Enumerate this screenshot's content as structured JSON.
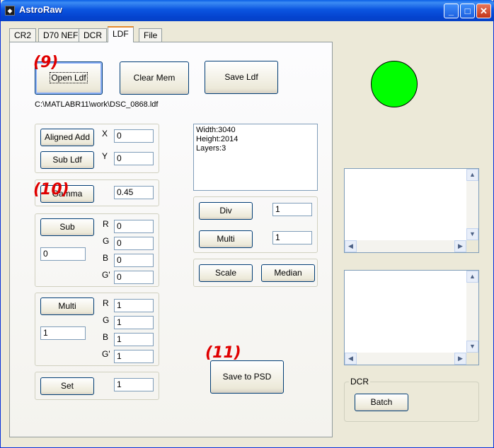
{
  "window": {
    "title": "AstroRaw",
    "minimize": "_",
    "maximize": "□",
    "close": "✕"
  },
  "tabs": [
    "CR2",
    "D70 NEF",
    "DCR",
    "LDF",
    "File"
  ],
  "active_tab": "LDF",
  "ldf": {
    "open_ldf": "Open Ldf",
    "clear_mem": "Clear Mem",
    "save_ldf": "Save Ldf",
    "file_path": "C:\\MATLABR11\\work\\DSC_0868.ldf",
    "aligned_add": "Aligned Add",
    "sub_ldf": "Sub Ldf",
    "x_label": "X",
    "x_value": "0",
    "y_label": "Y",
    "y_value": "0",
    "gamma": "Gamma",
    "gamma_value": "0.45",
    "info_lines": [
      "Width:3040",
      "Height:2014",
      "Layers:3"
    ],
    "div": "Div",
    "div_value": "1",
    "multi_top": "Multi",
    "multi_top_value": "1",
    "scale": "Scale",
    "median": "Median",
    "sub": "Sub",
    "sub_value": "0",
    "sub_r_label": "R",
    "sub_r": "0",
    "sub_g_label": "G",
    "sub_g": "0",
    "sub_b_label": "B",
    "sub_b": "0",
    "sub_g2_label": "G'",
    "sub_g2": "0",
    "multi": "Multi",
    "multi_value": "1",
    "multi_r_label": "R",
    "multi_r": "1",
    "multi_g_label": "G",
    "multi_g": "1",
    "multi_b_label": "B",
    "multi_b": "1",
    "multi_g2_label": "G'",
    "multi_g2": "1",
    "set": "Set",
    "set_value": "1",
    "save_psd": "Save to PSD"
  },
  "right": {
    "status_color": "#00ff00",
    "dcr_group": "DCR",
    "batch": "Batch"
  },
  "annotations": {
    "a9": "(9)",
    "a10": "(10)",
    "a11": "(11)"
  },
  "colors": {
    "title_bar": "#0b55e0",
    "annotation": "#e00000",
    "status": "#00ff00"
  }
}
